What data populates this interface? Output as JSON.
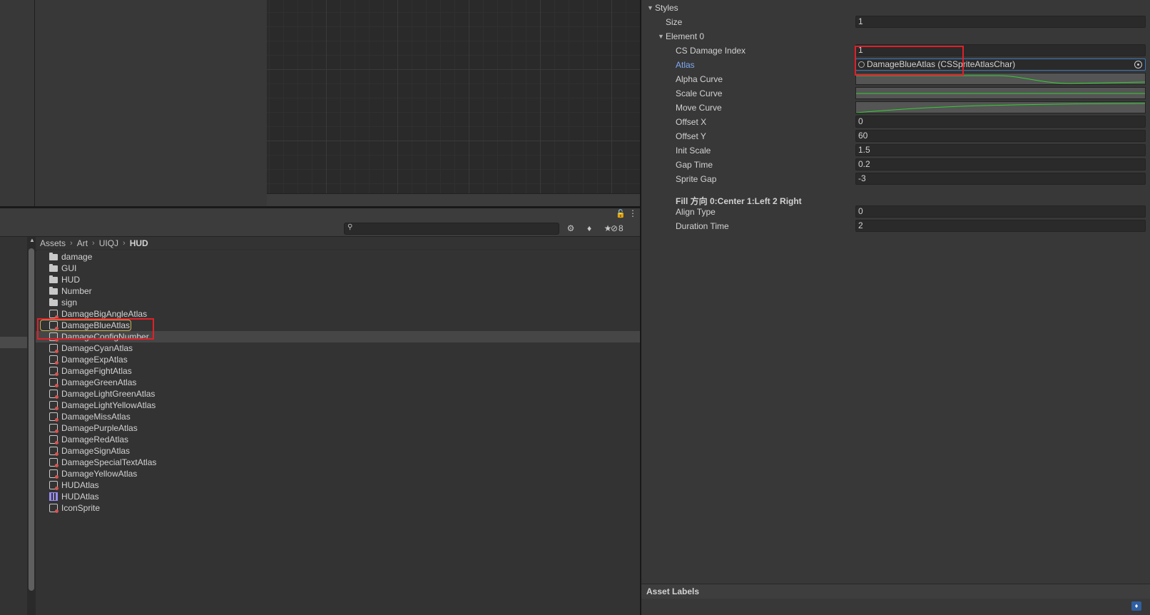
{
  "project": {
    "breadcrumb": [
      "Assets",
      "Art",
      "UIQJ",
      "HUD"
    ],
    "search_placeholder": "",
    "hidden_count": "8",
    "items": [
      {
        "name": "damage",
        "type": "folder"
      },
      {
        "name": "GUI",
        "type": "folder"
      },
      {
        "name": "HUD",
        "type": "folder"
      },
      {
        "name": "Number",
        "type": "folder"
      },
      {
        "name": "sign",
        "type": "folder"
      },
      {
        "name": "DamageBigAngleAtlas",
        "type": "prefab"
      },
      {
        "name": "DamageBlueAtlas",
        "type": "prefab"
      },
      {
        "name": "DamageConfigNumber",
        "type": "prefab"
      },
      {
        "name": "DamageCyanAtlas",
        "type": "prefab"
      },
      {
        "name": "DamageExpAtlas",
        "type": "prefab"
      },
      {
        "name": "DamageFightAtlas",
        "type": "prefab"
      },
      {
        "name": "DamageGreenAtlas",
        "type": "prefab"
      },
      {
        "name": "DamageLightGreenAtlas",
        "type": "prefab"
      },
      {
        "name": "DamageLightYellowAtlas",
        "type": "prefab"
      },
      {
        "name": "DamageMissAtlas",
        "type": "prefab"
      },
      {
        "name": "DamagePurpleAtlas",
        "type": "prefab"
      },
      {
        "name": "DamageRedAtlas",
        "type": "prefab"
      },
      {
        "name": "DamageSignAtlas",
        "type": "prefab"
      },
      {
        "name": "DamageSpecialTextAtlas",
        "type": "prefab"
      },
      {
        "name": "DamageYellowAtlas",
        "type": "prefab"
      },
      {
        "name": "HUDAtlas",
        "type": "prefab"
      },
      {
        "name": "HUDAtlas",
        "type": "sprite-atlas"
      },
      {
        "name": "IconSprite",
        "type": "prefab"
      }
    ],
    "selected_item": "DamageBlueAtlas"
  },
  "inspector": {
    "styles_label": "Styles",
    "size_label": "Size",
    "size_value": "1",
    "element_label": "Element 0",
    "cs_damage_index_label": "CS Damage Index",
    "cs_damage_index_value": "1",
    "atlas_label": "Atlas",
    "atlas_value": "DamageBlueAtlas (CSSpriteAtlasChar)",
    "alpha_curve_label": "Alpha Curve",
    "scale_curve_label": "Scale Curve",
    "move_curve_label": "Move Curve",
    "offset_x_label": "Offset X",
    "offset_x_value": "0",
    "offset_y_label": "Offset Y",
    "offset_y_value": "60",
    "init_scale_label": "Init Scale",
    "init_scale_value": "1.5",
    "gap_time_label": "Gap Time",
    "gap_time_value": "0.2",
    "sprite_gap_label": "Sprite Gap",
    "sprite_gap_value": "-3",
    "fill_header": "Fill 方向 0:Center 1:Left 2 Right",
    "align_type_label": "Align Type",
    "align_type_value": "0",
    "duration_time_label": "Duration Time",
    "duration_time_value": "2",
    "asset_labels": "Asset Labels",
    "curve_color": "#2fd12f"
  }
}
